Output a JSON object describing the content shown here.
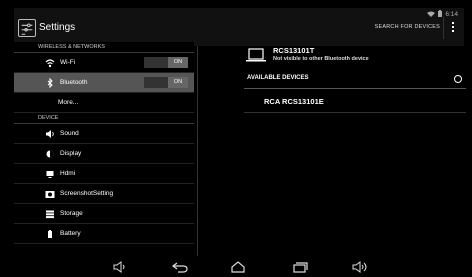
{
  "header": {
    "app_title": "Settings",
    "search_label": "SEARCH FOR DEVICES",
    "time": "6:14"
  },
  "sidebar": {
    "sections": [
      {
        "header": "WIRELESS & NETWORKS"
      },
      {
        "header": "DEVICE"
      }
    ],
    "items": [
      {
        "label": "Wi-Fi",
        "toggle": "ON",
        "icon": "wifi-icon"
      },
      {
        "label": "Bluetooth",
        "toggle": "ON",
        "icon": "bluetooth-icon",
        "selected": true
      },
      {
        "label": "More..."
      },
      {
        "label": "Sound",
        "icon": "speaker-icon"
      },
      {
        "label": "Display",
        "icon": "brightness-icon"
      },
      {
        "label": "Hdmi",
        "icon": "monitor-icon"
      },
      {
        "label": "ScreenshotSetting",
        "icon": "camera-icon"
      },
      {
        "label": "Storage",
        "icon": "storage-icon"
      },
      {
        "label": "Battery",
        "icon": "battery-icon"
      }
    ]
  },
  "bluetooth": {
    "device_name": "RCS13101T",
    "device_status": "Not visible to other Bluetooth device",
    "available_header": "AVAILABLE DEVICES",
    "available_devices": [
      "RCA RCS13101E"
    ]
  },
  "navbar": {
    "buttons": [
      "volume-down-icon",
      "back-icon",
      "home-icon",
      "recents-icon",
      "volume-up-icon"
    ]
  },
  "colors": {
    "selected_bg": "#555555",
    "toggle_on": "#666666",
    "background": "#000000"
  }
}
